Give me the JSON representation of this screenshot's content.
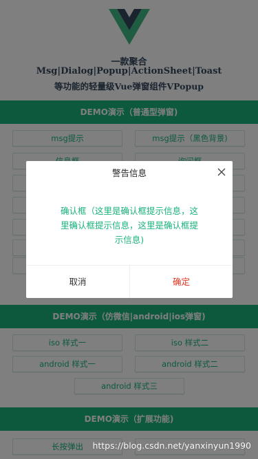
{
  "header": {
    "logo_icon": "vue-logo-icon",
    "line1": "一款聚合",
    "line2": "Msg|Dialog|Popup|ActionSheet|Toast",
    "line3": "等功能的轻量级Vue弹窗组件VPopup"
  },
  "sections": [
    {
      "title": "DEMO演示（普通型弹窗)"
    },
    {
      "title": "DEMO演示（仿微信|android|ios弹窗)"
    },
    {
      "title": "DEMO演示（扩展功能)"
    }
  ],
  "buttons": {
    "msg": "msg提示",
    "msg_dark": "msg提示（黑色背景)",
    "info": "信息框",
    "ask": "询问框",
    "ios1": "iso 样式一",
    "ios2": "iso 样式二",
    "android1": "android 样式一",
    "android2": "android 样式二",
    "android3": "android 样式三",
    "longpress": "长按弹出"
  },
  "dialog": {
    "title": "警告信息",
    "message": "确认框（这里是确认框提示信息，这里确认框提示信息，这里是确认框提示信息)",
    "cancel": "取消",
    "confirm": "确定",
    "close_icon": "close-icon",
    "message_color": "#19b37b",
    "confirm_color": "#e0341e"
  },
  "watermark": "https://blog.csdn.net/yanxinyun1990",
  "colors": {
    "accent": "#19b37b",
    "title_text": "#35495e",
    "mask": "rgba(0,0,0,0.5)"
  }
}
